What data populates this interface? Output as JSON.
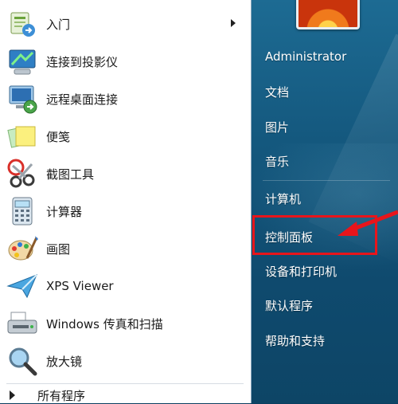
{
  "left_menu": {
    "items": [
      {
        "label": "入门",
        "icon": "getting-started-icon",
        "has_submenu": true
      },
      {
        "label": "连接到投影仪",
        "icon": "projector-icon"
      },
      {
        "label": "远程桌面连接",
        "icon": "remote-desktop-icon"
      },
      {
        "label": "便笺",
        "icon": "sticky-notes-icon"
      },
      {
        "label": "截图工具",
        "icon": "snipping-tool-icon"
      },
      {
        "label": "计算器",
        "icon": "calculator-icon"
      },
      {
        "label": "画图",
        "icon": "paint-icon"
      },
      {
        "label": "XPS Viewer",
        "icon": "xps-viewer-icon"
      },
      {
        "label": "Windows 传真和扫描",
        "icon": "fax-scan-icon"
      },
      {
        "label": "放大镜",
        "icon": "magnifier-icon"
      }
    ],
    "all_programs": "所有程序"
  },
  "right_menu": {
    "user": "Administrator",
    "items": [
      "文档",
      "图片",
      "音乐",
      "计算机",
      "控制面板",
      "设备和打印机",
      "默认程序",
      "帮助和支持"
    ]
  },
  "colors": {
    "right_pane": "#14587e",
    "highlight": "#e8151b"
  }
}
